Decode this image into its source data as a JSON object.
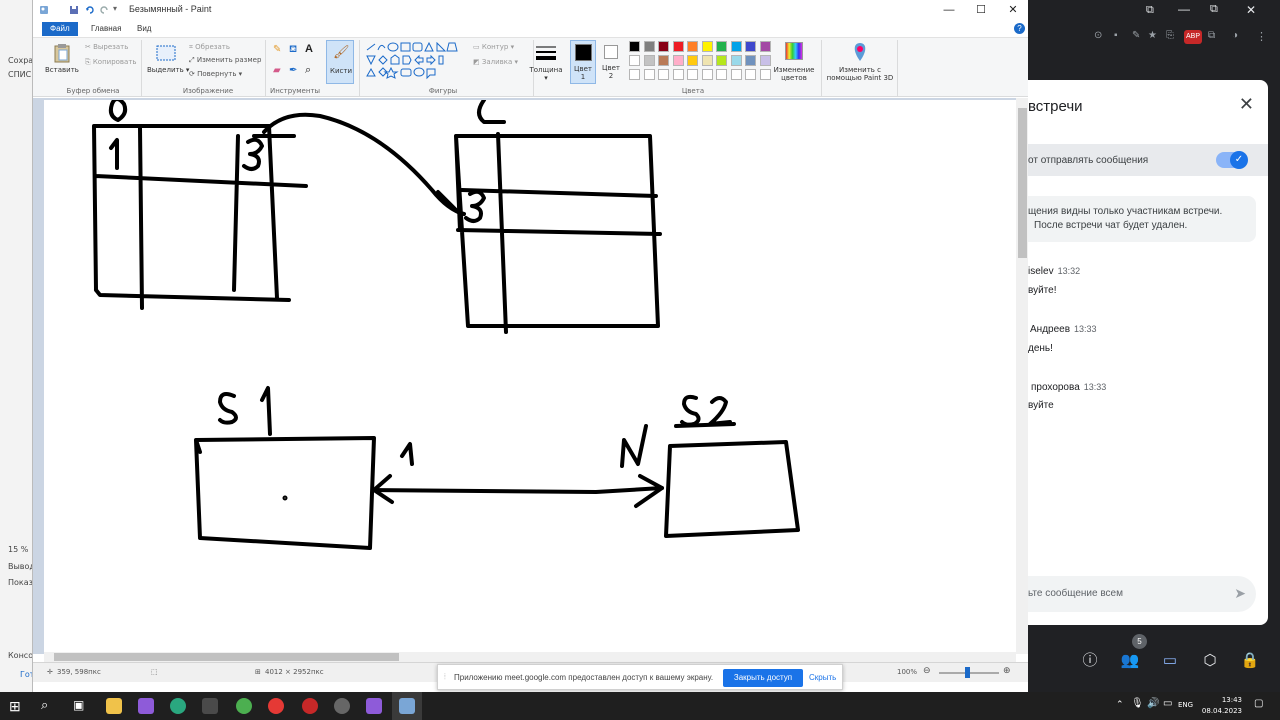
{
  "paint": {
    "title": "Безымянный - Paint",
    "tabs": [
      "Файл",
      "Главная",
      "Вид"
    ],
    "ribbon": {
      "paste": "Вставить",
      "cut": "Вырезать",
      "copy": "Копировать",
      "clipboard_group": "Буфер обмена",
      "select": "Выделить",
      "crop": "Обрезать",
      "resize": "Изменить размер",
      "rotate": "Повернуть",
      "image_group": "Изображение",
      "tools_group": "Инструменты",
      "brushes": "Кисти",
      "outline": "Контур",
      "fill": "Заливка",
      "shapes_group": "Фигуры",
      "size": "Толщина",
      "color1": "Цвет 1",
      "color2": "Цвет 2",
      "edit_colors": "Изменение цветов",
      "paint3d": "Изменить с помощью Paint 3D",
      "colors_group": "Цвета",
      "palette_row1": [
        "#000000",
        "#7f7f7f",
        "#880015",
        "#ed1c24",
        "#ff7f27",
        "#fff200",
        "#22b14c",
        "#00a2e8",
        "#3f48cc",
        "#a349a4"
      ],
      "palette_row2": [
        "#ffffff",
        "#c3c3c3",
        "#b97a57",
        "#ffaec9",
        "#ffc90e",
        "#efe4b0",
        "#b5e61d",
        "#99d9ea",
        "#7092be",
        "#c8bfe7"
      ]
    },
    "status": {
      "cursor": "359, 598пкс",
      "size": "4012 × 2952пкс",
      "zoom": "100%"
    },
    "drawing_labels": {
      "table1_header": "О",
      "table1_cell_a": "1",
      "table1_cell_b": "3",
      "table2_header": "С",
      "table2_cell": "3",
      "box1_label": "S 1",
      "box2_label": "S2",
      "card_left": "1",
      "card_right": "N"
    }
  },
  "left_strip": {
    "items": [
      "Сохра",
      "СПИС",
      "15 %",
      "Вывод",
      "Показ",
      "Консоль",
      "Гото"
    ]
  },
  "share_bar": {
    "text": "Приложению meet.google.com предоставлен доступ к вашему экрану.",
    "stop_label": "Закрыть доступ",
    "hide_label": "Скрыть"
  },
  "meet": {
    "title": "встречи",
    "setting_text": "от отправлять сообщения",
    "info_line1": "щения видны только участникам встречи.",
    "info_line2": "После встречи чат будет удален.",
    "messages": [
      {
        "name": "iselev",
        "time": "13:32",
        "text": "вуйте!"
      },
      {
        "name": "Андреев",
        "time": "13:33",
        "text": "день!"
      },
      {
        "name": "прохорова",
        "time": "13:33",
        "text": "вуйте"
      }
    ],
    "input_placeholder": "ьте сообщение всем",
    "participants_badge": "5"
  },
  "taskbar": {
    "lang": "ENG",
    "time": "13:43",
    "date": "08.04.2023"
  }
}
